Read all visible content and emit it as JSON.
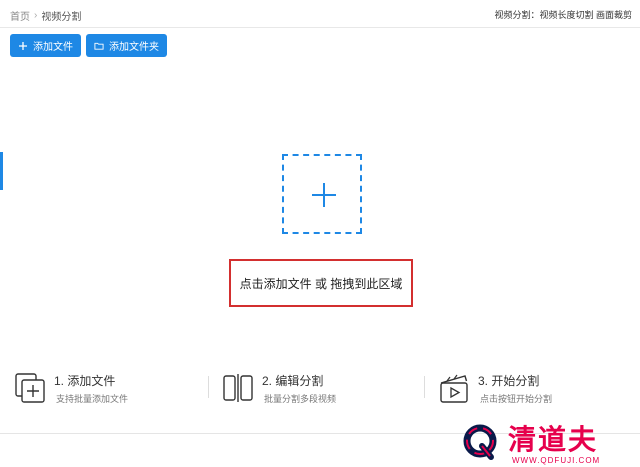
{
  "breadcrumb": {
    "home": "首页",
    "separator": "›",
    "current": "视频分割"
  },
  "header_info": "视频分割：视频长度切割 画面裁剪",
  "toolbar": {
    "add_file": {
      "label": "添加文件",
      "icon": "plus-icon"
    },
    "add_folder": {
      "label": "添加文件夹",
      "icon": "folder-icon"
    }
  },
  "dropzone": {
    "icon": "plus-icon",
    "hint": "点击添加文件 或 拖拽到此区域"
  },
  "steps": [
    {
      "title": "1. 添加文件",
      "desc": "支持批量添加文件",
      "icon": "add-files-icon"
    },
    {
      "title": "2. 编辑分割",
      "desc": "批量分割多段视频",
      "icon": "split-icon"
    },
    {
      "title": "3. 开始分割",
      "desc": "点击按钮开始分割",
      "icon": "clapper-play-icon"
    }
  ],
  "watermark": {
    "name": "清道夫",
    "url": "WWW.QDFUJI.COM"
  },
  "colors": {
    "accent": "#1e88e5",
    "highlight": "#d32f2f",
    "watermark": "#e6004c"
  }
}
